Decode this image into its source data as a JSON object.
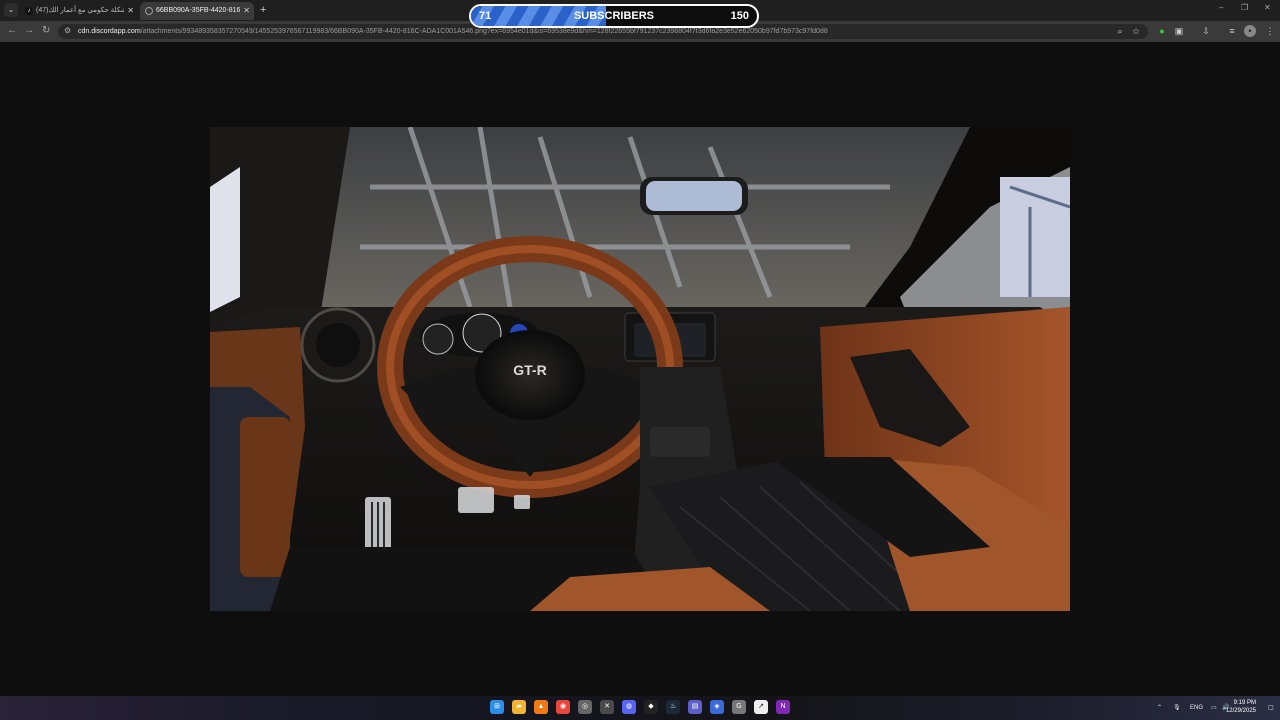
{
  "browser": {
    "tabs": [
      {
        "title": "(47)مشكلة حكومي مع أعمار الك...",
        "icon": "tiktok-icon",
        "active": false
      },
      {
        "title": "66BB090A-35FB-4420-816C-AD...",
        "icon": "globe-icon",
        "active": true
      }
    ],
    "new_tab": "+",
    "window_controls": {
      "minimize": "–",
      "restore": "❐",
      "close": "✕"
    },
    "address": {
      "domain": "cdn.discordapp.com",
      "path": "/attachments/993489358357270549/1455253976567119983/66BB090A-35FB-4420-816C-ADA1C001A546.png?ex=6954e01d&is=69538e9d&hm=128f22655bf791237c2396804f7f3d6fa2e3e52e62050b97fd7b973c97fd0d8"
    },
    "nav": {
      "back": "←",
      "forward": "→",
      "reload": "↻"
    }
  },
  "overlay": {
    "current": "71",
    "label": "SUBSCRIBERS",
    "goal": "150",
    "progress_fraction": 0.473,
    "fill_color": "#3b72d6"
  },
  "image": {
    "alt": "Nissan GT-R interior view from driver seat inside warehouse",
    "badge": "GT-R"
  },
  "taskbar": {
    "apps": [
      "windows-start-icon",
      "file-explorer-icon",
      "vlc-icon",
      "chrome-icon",
      "obs-icon",
      "xbox-icon",
      "discord-icon",
      "epic-games-icon",
      "steam-icon",
      "teams-icon",
      "remote-icon",
      "cortana-icon",
      "capcut-icon",
      "next-app-icon"
    ],
    "language": "ENG",
    "time": "9:19 PM",
    "date": "12/29/2025"
  }
}
